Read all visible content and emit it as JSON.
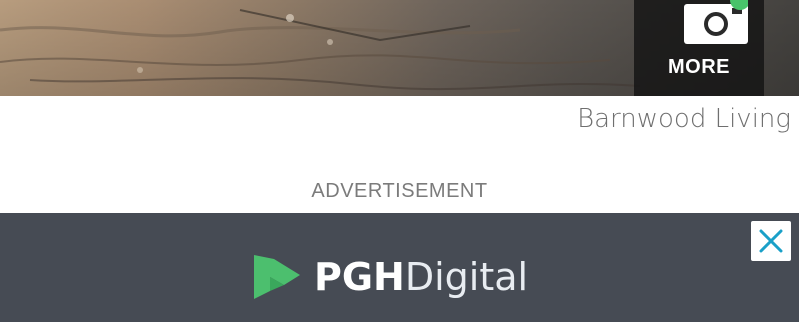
{
  "photo": {
    "more_button_label": "MORE",
    "camera_icon": "camera-icon"
  },
  "caption": {
    "source": "Barnwood Living"
  },
  "ad": {
    "label": "ADVERTISEMENT",
    "brand_bold": "PGH",
    "brand_light": "Digital",
    "close_icon": "close-icon",
    "colors": {
      "banner_bg": "#464b54",
      "close_x": "#1aa0c8",
      "logo_green": "#4cbf6e"
    }
  }
}
